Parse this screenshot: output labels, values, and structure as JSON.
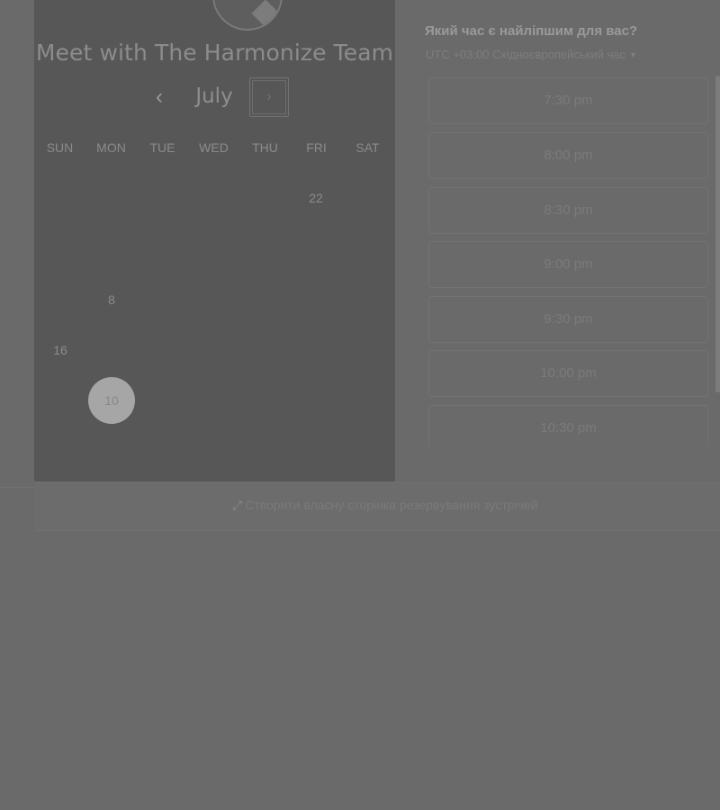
{
  "calendar": {
    "title": "Meet with The Harmonize Team",
    "month": "July",
    "prev_icon": "‹",
    "next_icon": "›",
    "weekdays": [
      "SUN",
      "MON",
      "TUE",
      "WED",
      "THU",
      "FRI",
      "SAT"
    ],
    "available_days": [
      "22",
      "8",
      "16",
      "10"
    ],
    "selected_day": "10"
  },
  "slots_panel": {
    "question": "Який час є найліпшим для вас?",
    "timezone": "UTC +03:00 Східноєвропейський час",
    "slots": [
      "7:30 pm",
      "8:00 pm",
      "8:30 pm",
      "9:00 pm",
      "9:30 pm",
      "10:00 pm",
      "10:30 pm"
    ]
  },
  "footer": {
    "link_text": "Створити власну сторінка резервування зустрічей"
  },
  "colors": {
    "overlay": "#6b6b6b",
    "panel": "#575757",
    "selected_day": "#a6a6a6"
  }
}
